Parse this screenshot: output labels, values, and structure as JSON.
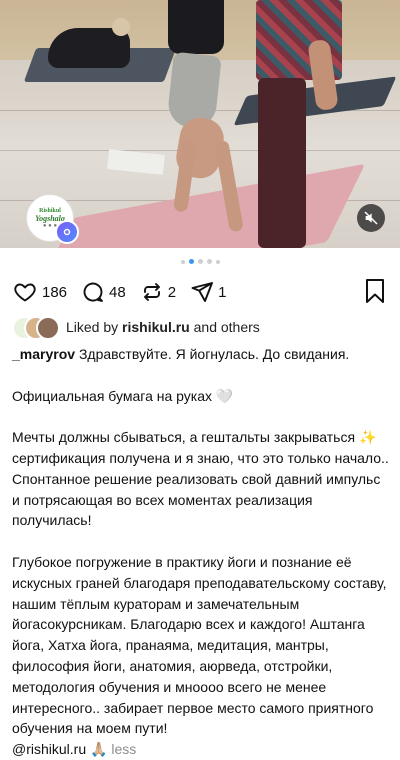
{
  "post": {
    "carousel": {
      "total_slides": 5,
      "active_index": 1
    },
    "media_badge": {
      "brand_top": "Rishikul",
      "brand_bottom": "Yogshala"
    },
    "actions": {
      "likes": "186",
      "comments": "48",
      "reposts": "2",
      "shares": "1"
    },
    "liked_by": {
      "prefix": "Liked by",
      "user": "rishikul.ru",
      "suffix": "and others"
    },
    "caption": {
      "username": "_maryrov",
      "line1": "Здравствуйте. Я йогнулась. До свидания.",
      "para2": "Официальная бумага на руках 🤍",
      "para3a": "Мечты должны сбываться, а гештальты закрываться ✨ сертификация получена и я знаю, что это только начало..",
      "para3b": "Спонтанное решение реализовать свой давний импульс и потрясающая во всех моментах реализация получилась!",
      "para4": "Глубокое погружение в практику йоги и познание её искусных граней благодаря преподавательскому составу, нашим тёплым кураторам и замечательным йогасокурсникам. Благодарю всех и каждого! Аштанга йога, Хатха йога, пранаяма, медитация, мантры, философия йоги, анатомия, аюрведа, отстройки, методология обучения и мноооо всего не менее интересного.. забирает первое место самого приятного обучения на моем пути!",
      "mention": "@rishikul.ru 🙏🏼",
      "less": "less"
    },
    "colors": {
      "active_dot": "#3897f0",
      "inactive_dot": "#cfcfcf",
      "secondary_text": "#8e8e8e",
      "mat_pink": "#dfa8ae"
    }
  }
}
